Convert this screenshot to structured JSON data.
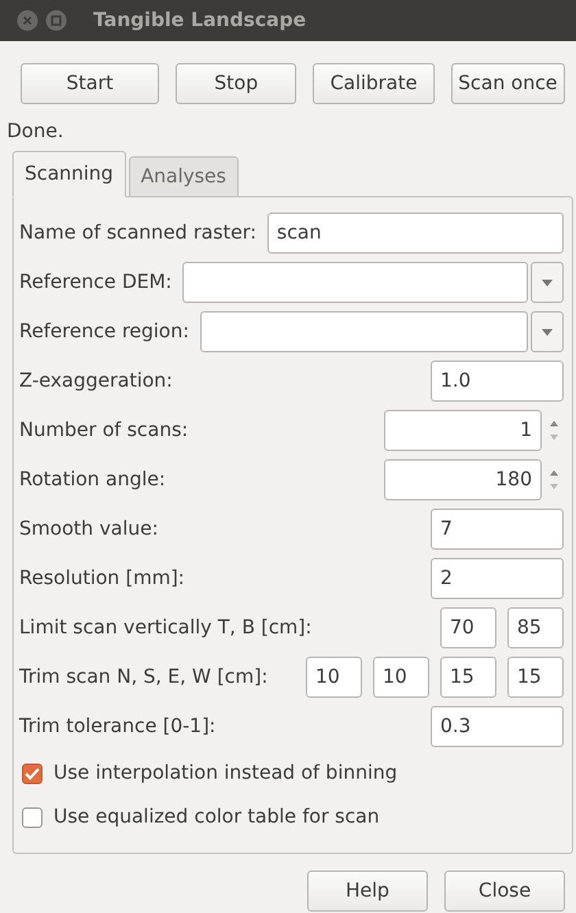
{
  "window": {
    "title": "Tangible Landscape"
  },
  "toolbar": [
    "Start",
    "Stop",
    "Calibrate",
    "Scan once"
  ],
  "status": "Done.",
  "tabs": [
    {
      "label": "Scanning",
      "selected": true
    },
    {
      "label": "Analyses",
      "selected": false
    }
  ],
  "fields": [
    {
      "kind": "text",
      "label": "Name of scanned raster:",
      "value": "scan"
    },
    {
      "kind": "combo",
      "label": "Reference DEM:"
    },
    {
      "kind": "combo",
      "label": "Reference region:"
    },
    {
      "kind": "number",
      "label": "Z-exaggeration:",
      "value": "1.0"
    },
    {
      "kind": "spin",
      "label": "Number of scans:",
      "value": "1"
    },
    {
      "kind": "spin",
      "label": "Rotation angle:",
      "value": "180"
    },
    {
      "kind": "number",
      "label": "Smooth value:",
      "value": "7"
    },
    {
      "kind": "number",
      "label": "Resolution [mm]:",
      "value": "2"
    },
    {
      "kind": "multi",
      "label": "Limit scan vertically T, B [cm]:",
      "values": [
        "70",
        "85"
      ]
    },
    {
      "kind": "multi",
      "label": "Trim scan N, S, E, W [cm]:",
      "values": [
        "10",
        "10",
        "15",
        "15"
      ]
    },
    {
      "kind": "number",
      "label": "Trim tolerance [0-1]:",
      "value": "0.3"
    },
    {
      "kind": "checkbox",
      "label": "Use interpolation instead of binning",
      "checked": true
    },
    {
      "kind": "checkbox",
      "label": "Use equalized color table for scan",
      "checked": false
    }
  ],
  "footer": [
    "Help",
    "Close"
  ]
}
